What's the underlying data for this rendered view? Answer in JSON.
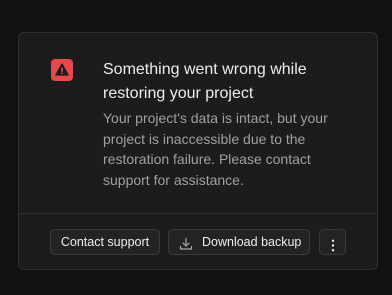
{
  "colors": {
    "page_background": "#111111",
    "card_background": "#1c1c1c",
    "border": "#2e2e2e",
    "warning_accent": "#e5484d",
    "title_text": "#ededed",
    "description_text": "#a0a0a0"
  },
  "alert": {
    "icon": "warning-triangle-icon",
    "title": "Something went wrong while restoring your project",
    "description": "Your project's data is intact, but your project is inaccessible due to the restoration failure. Please contact support for assistance."
  },
  "actions": {
    "contact_label": "Contact support",
    "download_label": "Download backup",
    "download_icon": "download-icon",
    "more_icon": "more-vertical-icon"
  }
}
